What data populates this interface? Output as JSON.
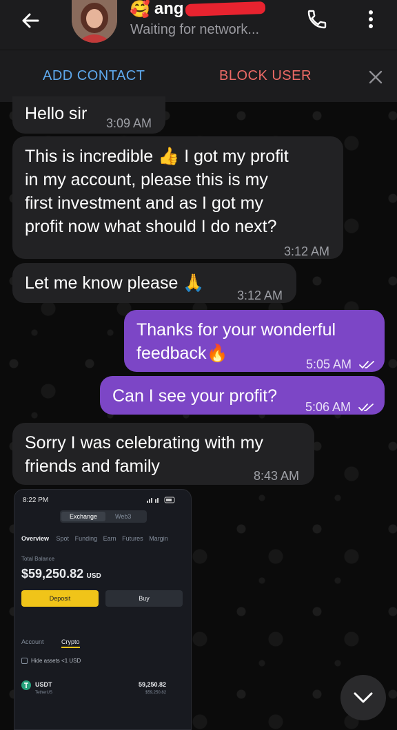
{
  "header": {
    "contact_name": "ang",
    "status": "Waiting for network...",
    "name_emoji": "🥰"
  },
  "action_bar": {
    "add_contact": "ADD CONTACT",
    "block_user": "BLOCK USER"
  },
  "messages": [
    {
      "text": "Hello sir",
      "time": "3:09 AM"
    },
    {
      "lines": [
        "This is incredible 👍 I got my profit",
        "in my account, please this is my",
        "first investment and as I got my",
        "profit now what should I do next?"
      ],
      "time": "3:12 AM"
    },
    {
      "text": "Let me know please 🙏",
      "time": "3:12 AM"
    },
    {
      "lines": [
        "Thanks for your wonderful",
        "feedback🔥"
      ],
      "time": "5:05 AM"
    },
    {
      "text": "Can I see your profit?",
      "time": "5:06 AM"
    },
    {
      "lines": [
        "Sorry I was celebrating with my",
        "friends and family"
      ],
      "time": "8:43 AM"
    }
  ],
  "screenshot": {
    "status_time": "8:22 PM",
    "tabs": [
      "Exchange",
      "Web3"
    ],
    "nav": [
      "Overview",
      "Spot",
      "Funding",
      "Earn",
      "Futures",
      "Margin"
    ],
    "total_balance_label": "Total Balance",
    "balance": "$59,250.82",
    "currency": "USD",
    "deposit": "Deposit",
    "buy": "Buy",
    "sub_tabs": [
      "Account",
      "Crypto"
    ],
    "hide_assets": "Hide assets <1 USD",
    "asset_symbol": "USDT",
    "asset_name": "TetherUS",
    "asset_amount": "59,250.82",
    "asset_value": "$59,250.82",
    "accent_color": "#f0c419"
  },
  "colors": {
    "incoming_bubble": "#222224",
    "outgoing_bubble": "#7c46c6",
    "add_contact": "#5ea8ec",
    "block_user": "#ec6a66"
  }
}
